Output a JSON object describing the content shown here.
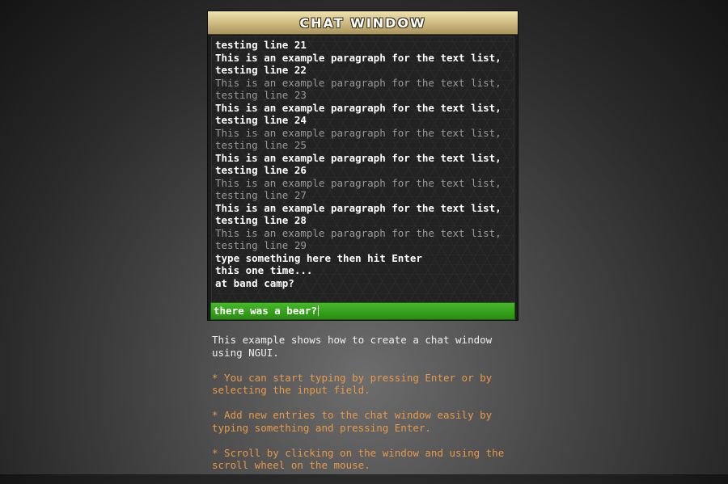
{
  "window": {
    "title": "CHAT WINDOW"
  },
  "chat": {
    "lines": [
      {
        "text": "testing line 21",
        "style": "bright"
      },
      {
        "text": "This is an example paragraph for the text list,",
        "style": "bright"
      },
      {
        "text": "testing line 22",
        "style": "bright"
      },
      {
        "text": "This is an example paragraph for the text list,",
        "style": "dim"
      },
      {
        "text": "testing line 23",
        "style": "dim"
      },
      {
        "text": "This is an example paragraph for the text list,",
        "style": "bright"
      },
      {
        "text": "testing line 24",
        "style": "bright"
      },
      {
        "text": "This is an example paragraph for the text list,",
        "style": "dim"
      },
      {
        "text": "testing line 25",
        "style": "dim"
      },
      {
        "text": "This is an example paragraph for the text list,",
        "style": "bright"
      },
      {
        "text": "testing line 26",
        "style": "bright"
      },
      {
        "text": "This is an example paragraph for the text list,",
        "style": "dim"
      },
      {
        "text": "testing line 27",
        "style": "dim"
      },
      {
        "text": "This is an example paragraph for the text list,",
        "style": "bright"
      },
      {
        "text": "testing line 28",
        "style": "bright"
      },
      {
        "text": "This is an example paragraph for the text list,",
        "style": "dim"
      },
      {
        "text": "testing line 29",
        "style": "dim"
      },
      {
        "text": "type something here then hit Enter",
        "style": "bright"
      },
      {
        "text": "this one time...",
        "style": "bright"
      },
      {
        "text": "at band camp?",
        "style": "bright"
      }
    ]
  },
  "input": {
    "value": "there was a bear?"
  },
  "description": {
    "intro_1": "This example shows how to create a chat window",
    "intro_2": "using NGUI.",
    "tip1_1": "* You can start typing by pressing Enter or by",
    "tip1_2": "selecting the input field.",
    "tip2_1": "* Add new entries to the chat window easily by",
    "tip2_2": "typing something and pressing Enter.",
    "tip3_1": "* Scroll by clicking on the window and using the",
    "tip3_2": "scroll wheel on the mouse."
  },
  "colors": {
    "accent_gold": "#c9b57a",
    "input_green": "#2e9a14",
    "tip_orange": "#e89a4a"
  }
}
